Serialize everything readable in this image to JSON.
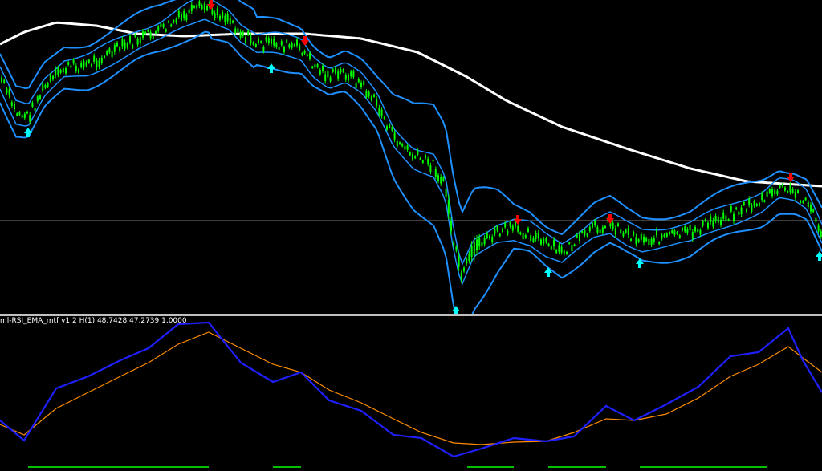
{
  "indicator": {
    "label": "ml-RSI_EMA_mtf v1.2 H(1) 48.7428 47.2739 1.0000"
  },
  "colors": {
    "background": "#000000",
    "candle": "#00ff00",
    "bollinger": "#1e90ff",
    "long_ma": "#ffffff",
    "horizontal_line": "#808080",
    "sell_arrow": "#ff0000",
    "buy_arrow": "#00ffff",
    "rsi_line": "#2020ff",
    "ema_line": "#ff8c00",
    "signal_bar": "#00c000",
    "separator": "#c0c0c0"
  },
  "signals": {
    "sell_arrows": 6,
    "buy_arrows": 6
  }
}
